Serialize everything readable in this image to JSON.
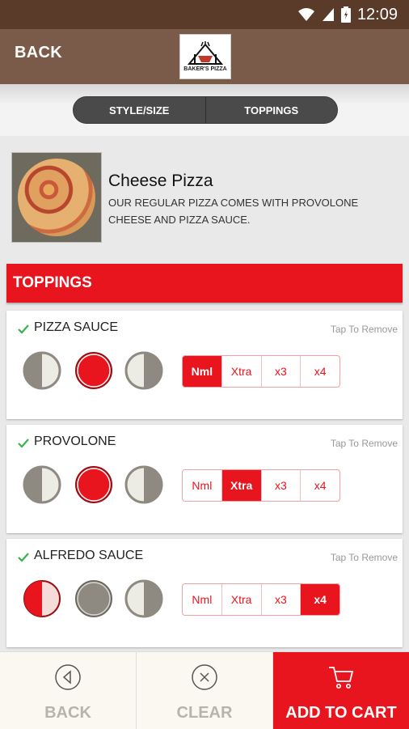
{
  "status_bar": {
    "time": "12:09",
    "icons": [
      "wifi-icon",
      "signal-icon",
      "battery-icon"
    ]
  },
  "header": {
    "back_label": "BACK",
    "logo_text": "BAKER'S PIZZA"
  },
  "tabs": [
    {
      "label": "STYLE/SIZE"
    },
    {
      "label": "TOPPINGS"
    }
  ],
  "product": {
    "name": "Cheese Pizza",
    "description": "OUR REGULAR PIZZA COMES WITH PROVOLONE CHEESE AND PIZZA SAUCE."
  },
  "toppings_header": "TOPPINGS",
  "toppings": [
    {
      "name": "PIZZA SAUCE",
      "remove_hint": "Tap To Remove",
      "portion": "whole",
      "amount": "Nml",
      "amount_options": [
        "Nml",
        "Xtra",
        "x3",
        "x4"
      ]
    },
    {
      "name": "PROVOLONE",
      "remove_hint": "Tap To Remove",
      "portion": "whole",
      "amount": "Xtra",
      "amount_options": [
        "Nml",
        "Xtra",
        "x3",
        "x4"
      ]
    },
    {
      "name": "ALFREDO SAUCE",
      "remove_hint": "Tap To Remove",
      "portion": "left",
      "amount": "x4",
      "amount_options": [
        "Nml",
        "Xtra",
        "x3",
        "x4"
      ]
    }
  ],
  "bottom_bar": {
    "back_label": "BACK",
    "clear_label": "CLEAR",
    "add_label": "ADD TO CART"
  },
  "colors": {
    "accent": "#e8141e",
    "header_brown": "#7a5a48",
    "status_brown": "#5a3a28",
    "check_green": "#3cb24a"
  }
}
